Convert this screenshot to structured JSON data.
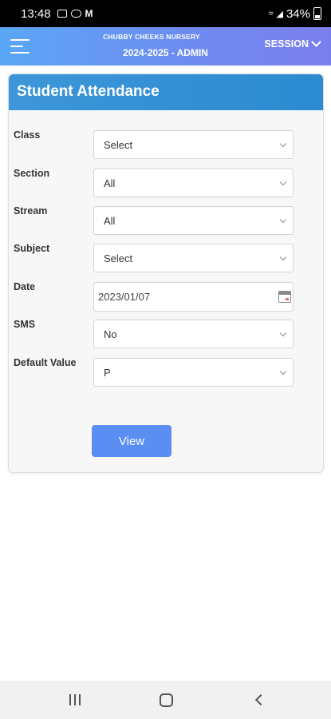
{
  "status_bar": {
    "time": "13:48",
    "left_icons": [
      "gallery-icon",
      "cast-icon",
      "gmail-icon"
    ],
    "right_icons": [
      "wifi-call-icon",
      "signal-icon"
    ],
    "battery": "34%"
  },
  "header": {
    "school_name": "CHUBBY CHEEKS NURSERY",
    "session_year": "2024-2025 - ADMIN",
    "session_label": "SESSION",
    "gradient_start": "#5aa7f6",
    "gradient_end": "#7b7fee"
  },
  "card": {
    "title": "Student Attendance",
    "title_bg": "#3d97d8"
  },
  "form": {
    "class": {
      "label": "Class",
      "value": "Select"
    },
    "section": {
      "label": "Section",
      "value": "All"
    },
    "stream": {
      "label": "Stream",
      "value": "All"
    },
    "subject": {
      "label": "Subject",
      "value": "Select"
    },
    "date": {
      "label": "Date",
      "value": "2023/01/07"
    },
    "sms": {
      "label": "SMS",
      "value": "No"
    },
    "default_value": {
      "label": "Default Value",
      "value": "P"
    }
  },
  "actions": {
    "view_label": "View",
    "view_color": "#5b8ef3"
  },
  "nav_bar": {
    "icons": [
      "recents-icon",
      "home-icon",
      "back-icon"
    ]
  }
}
